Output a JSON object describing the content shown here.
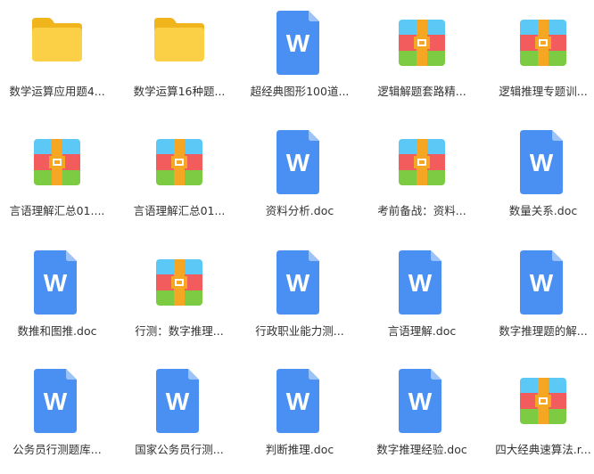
{
  "colors": {
    "folder_back": "#F0B41C",
    "folder_front": "#FBD046",
    "word_body": "#4A90F2",
    "word_fold": "#9CC3F8",
    "word_letter": "#FFFFFF",
    "zip_blue": "#5BC8F5",
    "zip_red": "#F25C5C",
    "zip_green": "#7DCB43",
    "zip_band": "#F5A623",
    "zip_clasp": "#FFFFFF",
    "label_text": "#333333"
  },
  "word_icon_letter": "W",
  "files": [
    {
      "name": "数学运算应用题4...",
      "icon": "folder-icon"
    },
    {
      "name": "数学运算16种题...",
      "icon": "folder-icon"
    },
    {
      "name": "超经典图形100道...",
      "icon": "word-doc-icon"
    },
    {
      "name": "逻辑解题套路精...",
      "icon": "archive-icon"
    },
    {
      "name": "逻辑推理专题训...",
      "icon": "archive-icon"
    },
    {
      "name": "言语理解汇总01....",
      "icon": "archive-icon"
    },
    {
      "name": "言语理解汇总01...",
      "icon": "archive-icon"
    },
    {
      "name": "资料分析.doc",
      "icon": "word-doc-icon"
    },
    {
      "name": "考前备战：资料...",
      "icon": "archive-icon"
    },
    {
      "name": "数量关系.doc",
      "icon": "word-doc-icon"
    },
    {
      "name": "数推和图推.doc",
      "icon": "word-doc-icon"
    },
    {
      "name": "行测：数字推理...",
      "icon": "archive-icon"
    },
    {
      "name": "行政职业能力测...",
      "icon": "word-doc-icon"
    },
    {
      "name": "言语理解.doc",
      "icon": "word-doc-icon"
    },
    {
      "name": "数字推理题的解...",
      "icon": "word-doc-icon"
    },
    {
      "name": "公务员行测题库...",
      "icon": "word-doc-icon"
    },
    {
      "name": "国家公务员行测...",
      "icon": "word-doc-icon"
    },
    {
      "name": "判断推理.doc",
      "icon": "word-doc-icon"
    },
    {
      "name": "数字推理经验.doc",
      "icon": "word-doc-icon"
    },
    {
      "name": "四大经典速算法.r...",
      "icon": "archive-icon"
    }
  ]
}
